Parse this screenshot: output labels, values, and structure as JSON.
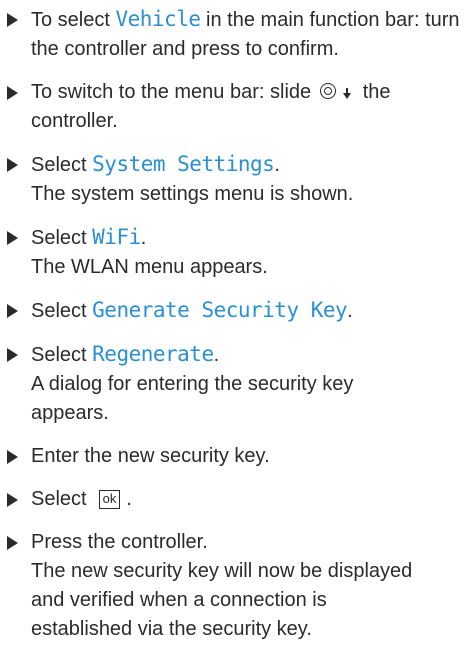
{
  "steps": [
    {
      "pre": "To select ",
      "ui": "Vehicle",
      "post": " in the main function bar: turn the controller and press to confirm."
    },
    {
      "pre": "To switch to the menu bar: slide ",
      "knob_icon": "controller-knob-icon",
      "arrow_icon": "arrow-down-icon",
      "post": "the controller."
    },
    {
      "pre": "Select ",
      "ui": "System Settings",
      "post": ".",
      "result": "The system settings menu is shown."
    },
    {
      "pre": "Select ",
      "ui": "WiFi",
      "post": ".",
      "result": "The WLAN menu appears."
    },
    {
      "pre": "Select ",
      "ui": "Generate Security Key",
      "post": "."
    },
    {
      "pre": "Select ",
      "ui": "Regenerate",
      "post": ".",
      "result_lines": [
        "A dialog for entering the security key",
        "appears."
      ]
    },
    {
      "text": "Enter the new security key."
    },
    {
      "pre": "Select",
      "key": "ok",
      "post": "."
    },
    {
      "text": "Press the controller.",
      "result_lines": [
        "The new security key will now be displayed",
        "and verified when a connection is",
        "established via the security key."
      ]
    }
  ]
}
